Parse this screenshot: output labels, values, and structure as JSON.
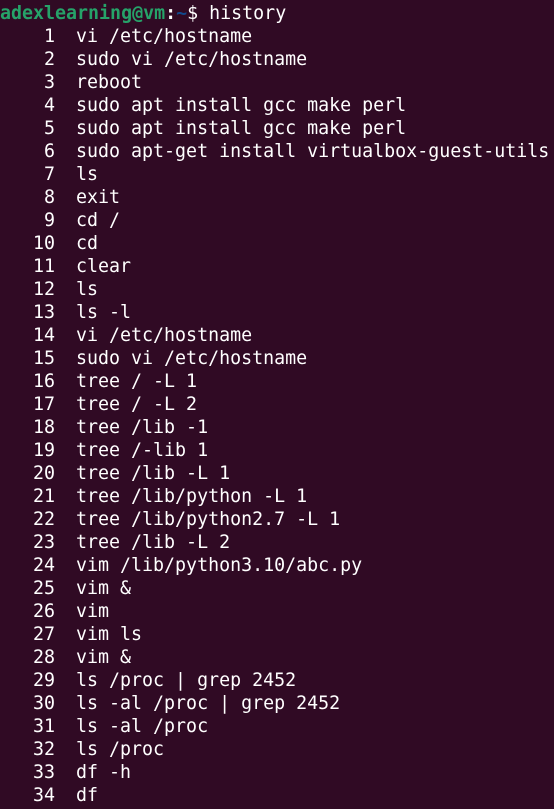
{
  "prompt": {
    "user_host": "adexlearning@vm",
    "separator": ":",
    "path": "~",
    "symbol": "$",
    "command": "history"
  },
  "history": [
    {
      "num": "1",
      "cmd": "vi /etc/hostname"
    },
    {
      "num": "2",
      "cmd": "sudo vi /etc/hostname"
    },
    {
      "num": "3",
      "cmd": "reboot"
    },
    {
      "num": "4",
      "cmd": "sudo apt install gcc make perl"
    },
    {
      "num": "5",
      "cmd": "sudo apt install gcc make perl"
    },
    {
      "num": "6",
      "cmd": "sudo apt-get install virtualbox-guest-utils"
    },
    {
      "num": "7",
      "cmd": "ls"
    },
    {
      "num": "8",
      "cmd": "exit"
    },
    {
      "num": "9",
      "cmd": "cd /"
    },
    {
      "num": "10",
      "cmd": "cd"
    },
    {
      "num": "11",
      "cmd": "clear"
    },
    {
      "num": "12",
      "cmd": "ls"
    },
    {
      "num": "13",
      "cmd": "ls -l"
    },
    {
      "num": "14",
      "cmd": "vi /etc/hostname"
    },
    {
      "num": "15",
      "cmd": "sudo vi /etc/hostname"
    },
    {
      "num": "16",
      "cmd": "tree / -L 1"
    },
    {
      "num": "17",
      "cmd": "tree / -L 2"
    },
    {
      "num": "18",
      "cmd": "tree /lib -1"
    },
    {
      "num": "19",
      "cmd": "tree /-lib 1"
    },
    {
      "num": "20",
      "cmd": "tree /lib -L 1"
    },
    {
      "num": "21",
      "cmd": "tree /lib/python -L 1"
    },
    {
      "num": "22",
      "cmd": "tree /lib/python2.7 -L 1"
    },
    {
      "num": "23",
      "cmd": "tree /lib -L 2"
    },
    {
      "num": "24",
      "cmd": "vim /lib/python3.10/abc.py"
    },
    {
      "num": "25",
      "cmd": "vim &"
    },
    {
      "num": "26",
      "cmd": "vim"
    },
    {
      "num": "27",
      "cmd": "vim ls"
    },
    {
      "num": "28",
      "cmd": "vim &"
    },
    {
      "num": "29",
      "cmd": "ls /proc | grep 2452"
    },
    {
      "num": "30",
      "cmd": "ls -al /proc | grep 2452"
    },
    {
      "num": "31",
      "cmd": "ls -al /proc"
    },
    {
      "num": "32",
      "cmd": "ls /proc"
    },
    {
      "num": "33",
      "cmd": "df -h"
    },
    {
      "num": "34",
      "cmd": "df"
    }
  ]
}
